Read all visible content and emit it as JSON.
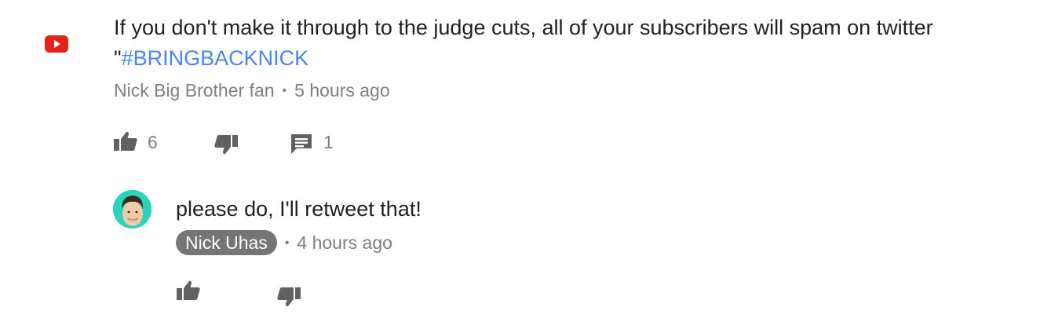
{
  "comment": {
    "text_line1": "If you don't make it through to the judge cuts, all of your subscribers will spam on twitter",
    "text_quote": "\"",
    "hashtag": "#BRINGBACKNICK",
    "author": "Nick Big Brother fan",
    "separator": "•",
    "time": "5 hours ago",
    "like_count": "6",
    "reply_count": "1",
    "icons": [
      "youtube-logo-icon",
      "thumbs-up-icon",
      "thumbs-down-icon",
      "reply-comment-icon"
    ]
  },
  "reply": {
    "text": "please do, I'll retweet that!",
    "author": "Nick Uhas",
    "separator": "•",
    "time": "4 hours ago",
    "icons": [
      "avatar",
      "thumbs-up-icon",
      "thumbs-down-icon"
    ]
  },
  "colors": {
    "hashtag": "#4a86e8",
    "youtube_red": "#e62117",
    "meta_gray": "#7f7f7f",
    "chip_gray": "#757575",
    "avatar_bg": "#2ad4b8"
  }
}
